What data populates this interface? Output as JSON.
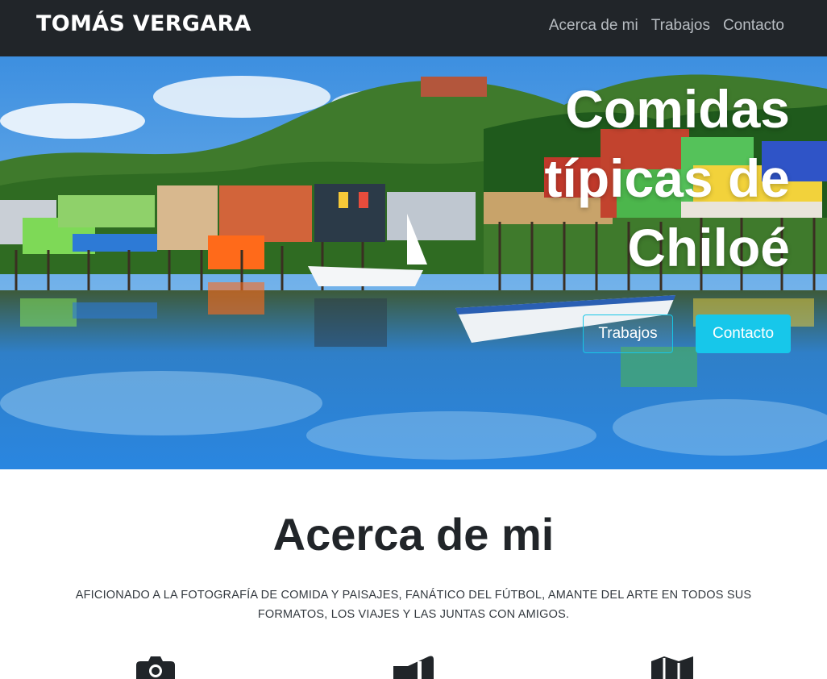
{
  "navbar": {
    "brand": "TOMÁS VERGARA",
    "links": [
      "Acerca de mi",
      "Trabajos",
      "Contacto"
    ]
  },
  "hero": {
    "title": "Comidas típicas de Chiloé",
    "buttons": {
      "outline": "Trabajos",
      "primary": "Contacto"
    }
  },
  "about": {
    "title": "Acerca de mi",
    "text": "AFICIONADO A LA FOTOGRAFÍA DE COMIDA Y PAISAJES, FANÁTICO DEL FÚTBOL, AMANTE DEL ARTE EN TODOS SUS FORMATOS, LOS VIAJES Y LAS JUNTAS CON AMIGOS.",
    "icons": [
      "camera-icon",
      "megaphone-icon",
      "map-icon"
    ]
  },
  "colors": {
    "navbar_bg": "#212529",
    "accent": "#17c7ea",
    "text_dark": "#212529"
  }
}
